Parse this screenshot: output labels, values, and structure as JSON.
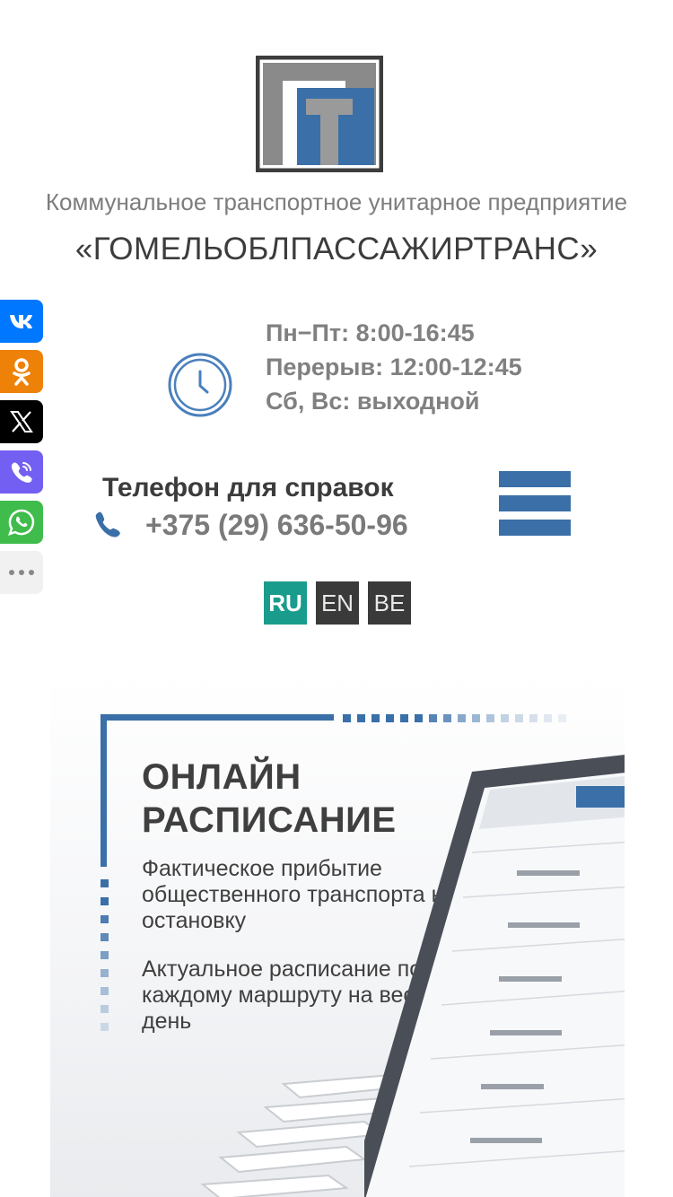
{
  "header": {
    "subtitle": "Коммунальное транспортное унитарное предприятие",
    "name": "«ГОМЕЛЬОБЛПАССАЖИРТРАНС»"
  },
  "share": {
    "buttons": [
      {
        "icon": "vk-icon",
        "label": "VK"
      },
      {
        "icon": "odnoklassniki-icon",
        "label": "OK"
      },
      {
        "icon": "x-icon",
        "label": "X"
      },
      {
        "icon": "viber-icon",
        "label": "Viber"
      },
      {
        "icon": "whatsapp-icon",
        "label": "WhatsApp"
      },
      {
        "icon": "more-icon",
        "label": "More"
      }
    ]
  },
  "hours": {
    "weekdays": "Пн−Пт: 8:00-16:45",
    "break": "Перерыв: 12:00-12:45",
    "weekend": "Сб, Вс: выходной"
  },
  "contact": {
    "label": "Телефон для справок",
    "phone": "+375 (29) 636-50-96"
  },
  "languages": {
    "ru": "RU",
    "en": "EN",
    "be": "BE",
    "active": "RU"
  },
  "banner": {
    "title_line1": "ОНЛАЙН",
    "title_line2": "РАСПИСАНИЕ",
    "p1": "Фактическое прибытие общественного транспорта на остановку",
    "p2": "Актуальное расписание по каждому маршруту на весь день"
  },
  "colors": {
    "brand_blue": "#3a6fa8",
    "active_lang": "#1a9c8c",
    "inactive_lang": "#3a3a3a"
  }
}
